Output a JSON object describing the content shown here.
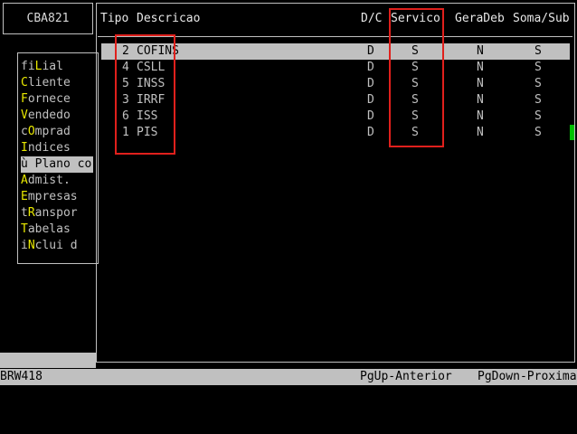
{
  "app_title": "CBA821",
  "menu": {
    "items": [
      {
        "prefix": "",
        "hot": "",
        "pre": "fi",
        "hotkey": "L",
        "rest": "ial ",
        "selected": false
      },
      {
        "prefix": "",
        "pre": "",
        "hotkey": "C",
        "rest": "liente",
        "selected": false
      },
      {
        "prefix": "",
        "pre": "",
        "hotkey": "F",
        "rest": "ornece",
        "selected": false
      },
      {
        "prefix": "",
        "pre": "",
        "hotkey": "V",
        "rest": "endedo",
        "selected": false
      },
      {
        "prefix": "",
        "pre": "c",
        "hotkey": "O",
        "rest": "mprad",
        "selected": false
      },
      {
        "prefix": "",
        "pre": "",
        "hotkey": "I",
        "rest": "ndices",
        "selected": false
      },
      {
        "prefix": "ù ",
        "pre": "",
        "hotkey": "P",
        "rest": "lano co",
        "selected": true
      },
      {
        "prefix": "",
        "pre": "",
        "hotkey": "A",
        "rest": "dmist.",
        "selected": false
      },
      {
        "prefix": "",
        "pre": "",
        "hotkey": "E",
        "rest": "mpresas",
        "selected": false
      },
      {
        "prefix": "",
        "pre": "t",
        "hotkey": "R",
        "rest": "anspor",
        "selected": false
      },
      {
        "prefix": "",
        "pre": "",
        "hotkey": "T",
        "rest": "abelas",
        "selected": false
      },
      {
        "prefix": "",
        "pre": "i",
        "hotkey": "N",
        "rest": "clui d",
        "selected": false
      }
    ]
  },
  "table": {
    "headers": {
      "tipo": "Tipo",
      "descricao": "Descricao",
      "dc": "D/C",
      "servico": "Servico",
      "geradeb": "GeraDeb",
      "somasub": "Soma/Sub"
    },
    "rows": [
      {
        "tipo": "2",
        "descricao": "COFINS",
        "dc": "D",
        "servico": "S",
        "geradeb": "N",
        "somasub": "S",
        "selected": true
      },
      {
        "tipo": "4",
        "descricao": "CSLL",
        "dc": "D",
        "servico": "S",
        "geradeb": "N",
        "somasub": "S",
        "selected": false
      },
      {
        "tipo": "5",
        "descricao": "INSS",
        "dc": "D",
        "servico": "S",
        "geradeb": "N",
        "somasub": "S",
        "selected": false
      },
      {
        "tipo": "3",
        "descricao": "IRRF",
        "dc": "D",
        "servico": "S",
        "geradeb": "N",
        "somasub": "S",
        "selected": false
      },
      {
        "tipo": "6",
        "descricao": "ISS",
        "dc": "D",
        "servico": "S",
        "geradeb": "N",
        "somasub": "S",
        "selected": false
      },
      {
        "tipo": "1",
        "descricao": "PIS",
        "dc": "D",
        "servico": "S",
        "geradeb": "N",
        "somasub": "S",
        "selected": false
      }
    ]
  },
  "status": {
    "program": "BRW418",
    "pgup": "PgUp-Anterior",
    "pgdown": "PgDown-Proxima"
  },
  "colors": {
    "highlight": "#e8e800",
    "annotation": "#e0201c",
    "marker": "#00c000"
  }
}
